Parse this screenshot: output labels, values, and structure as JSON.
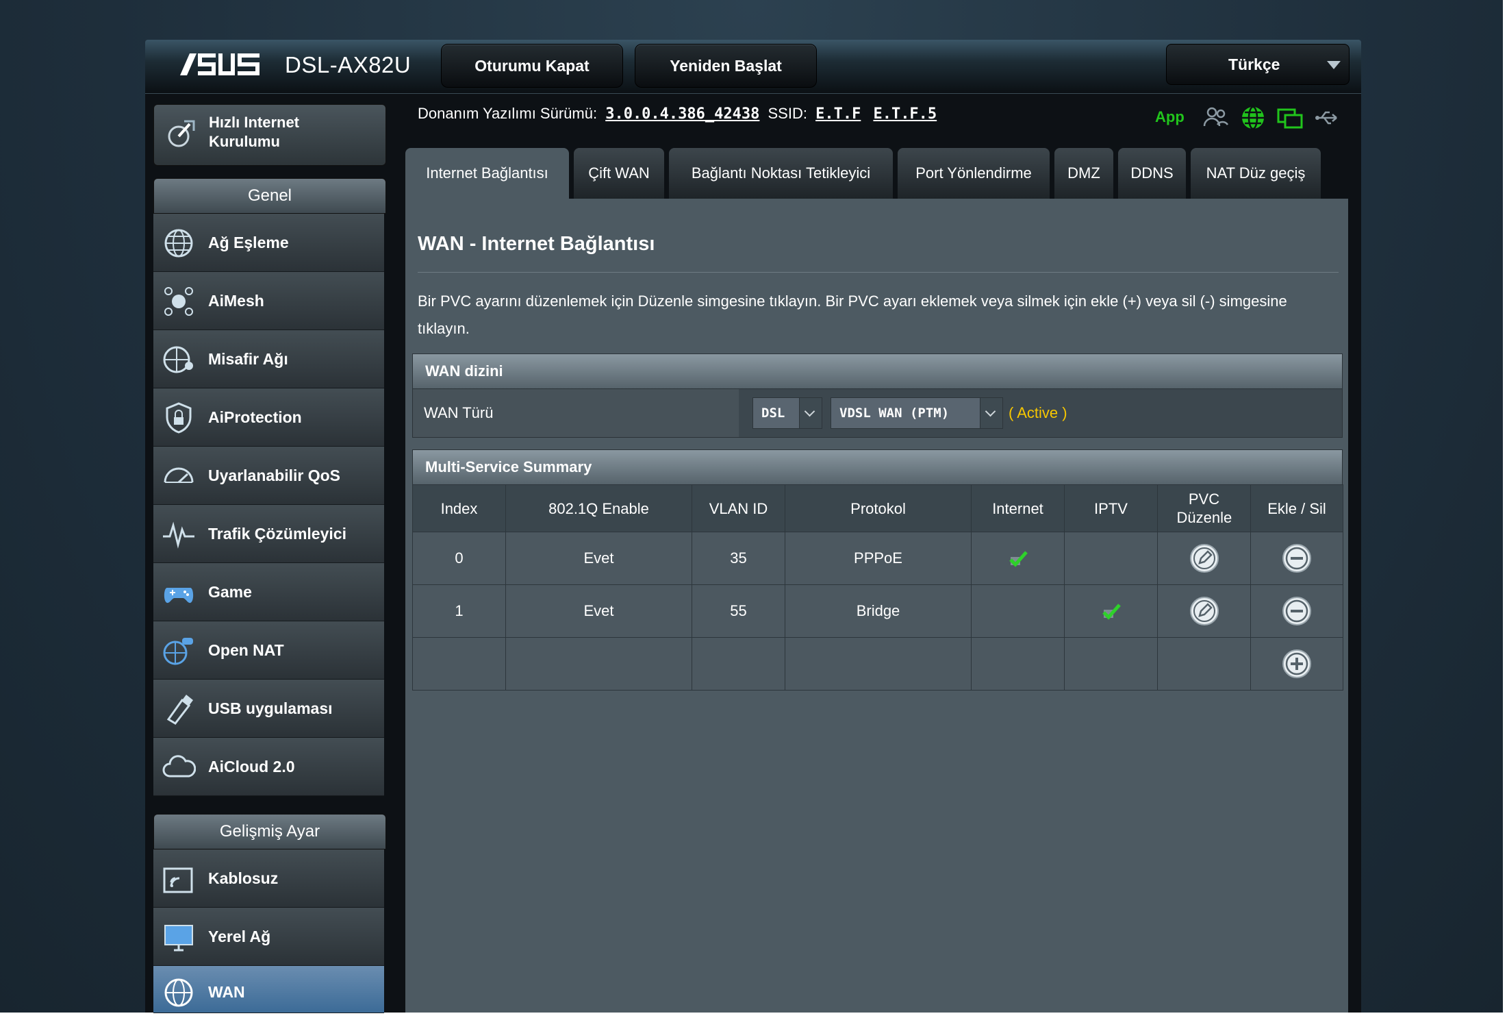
{
  "header": {
    "model": "DSL-AX82U",
    "logout_label": "Oturumu Kapat",
    "reboot_label": "Yeniden Başlat",
    "language": "Türkçe"
  },
  "info": {
    "firmware_label": "Donanım Yazılımı Sürümü:",
    "firmware_version": "3.0.0.4.386_42438",
    "ssid_label": "SSID:",
    "ssid_1": "E.T.F",
    "ssid_2": "E.T.F.5",
    "app_label": "App"
  },
  "sidebar": {
    "quick_setup": "Hızlı Internet Kurulumu",
    "general_heading": "Genel",
    "general_items": [
      {
        "label": "Ağ Eşleme",
        "icon": "globe-network-icon"
      },
      {
        "label": "AiMesh",
        "icon": "aimesh-icon"
      },
      {
        "label": "Misafir Ağı",
        "icon": "guest-network-icon"
      },
      {
        "label": "AiProtection",
        "icon": "shield-lock-icon"
      },
      {
        "label": "Uyarlanabilir QoS",
        "icon": "speedometer-icon"
      },
      {
        "label": "Trafik Çözümleyici",
        "icon": "traffic-wave-icon"
      },
      {
        "label": "Game",
        "icon": "gamepad-icon"
      },
      {
        "label": "Open NAT",
        "icon": "open-nat-icon"
      },
      {
        "label": "USB uygulaması",
        "icon": "usb-icon"
      },
      {
        "label": "AiCloud 2.0",
        "icon": "cloud-icon"
      }
    ],
    "advanced_heading": "Gelişmiş Ayar",
    "advanced_items": [
      {
        "label": "Kablosuz",
        "icon": "wireless-icon"
      },
      {
        "label": "Yerel Ağ",
        "icon": "lan-monitor-icon"
      },
      {
        "label": "WAN",
        "icon": "wan-globe-icon"
      }
    ]
  },
  "tabs": [
    "Internet Bağlantısı",
    "Çift WAN",
    "Bağlantı Noktası Tetikleyici",
    "Port Yönlendirme",
    "DMZ",
    "DDNS",
    "NAT Düz geçiş"
  ],
  "page": {
    "title": "WAN - Internet Bağlantısı",
    "description": "Bir PVC ayarını düzenlemek için Düzenle simgesine tıklayın. Bir PVC ayarı eklemek veya silmek için ekle (+) veya sil (-) simgesine tıklayın."
  },
  "wan_index": {
    "heading": "WAN dizini",
    "type_label": "WAN Türü",
    "type_value": "DSL",
    "mode_value": "VDSL WAN (PTM)",
    "status": "( Active )"
  },
  "summary": {
    "heading": "Multi-Service Summary",
    "columns": [
      "Index",
      "802.1Q Enable",
      "VLAN ID",
      "Protokol",
      "Internet",
      "IPTV",
      "PVC Düzenle",
      "Ekle / Sil"
    ],
    "rows": [
      {
        "index": "0",
        "enable": "Evet",
        "vlan": "35",
        "protocol": "PPPoE",
        "internet": true,
        "iptv": false
      },
      {
        "index": "1",
        "enable": "Evet",
        "vlan": "55",
        "protocol": "Bridge",
        "internet": false,
        "iptv": true
      }
    ]
  },
  "colors": {
    "accent_green": "#21c41c",
    "status_yellow": "#f7c700",
    "active_nav_blue": "#4f7ca6"
  }
}
